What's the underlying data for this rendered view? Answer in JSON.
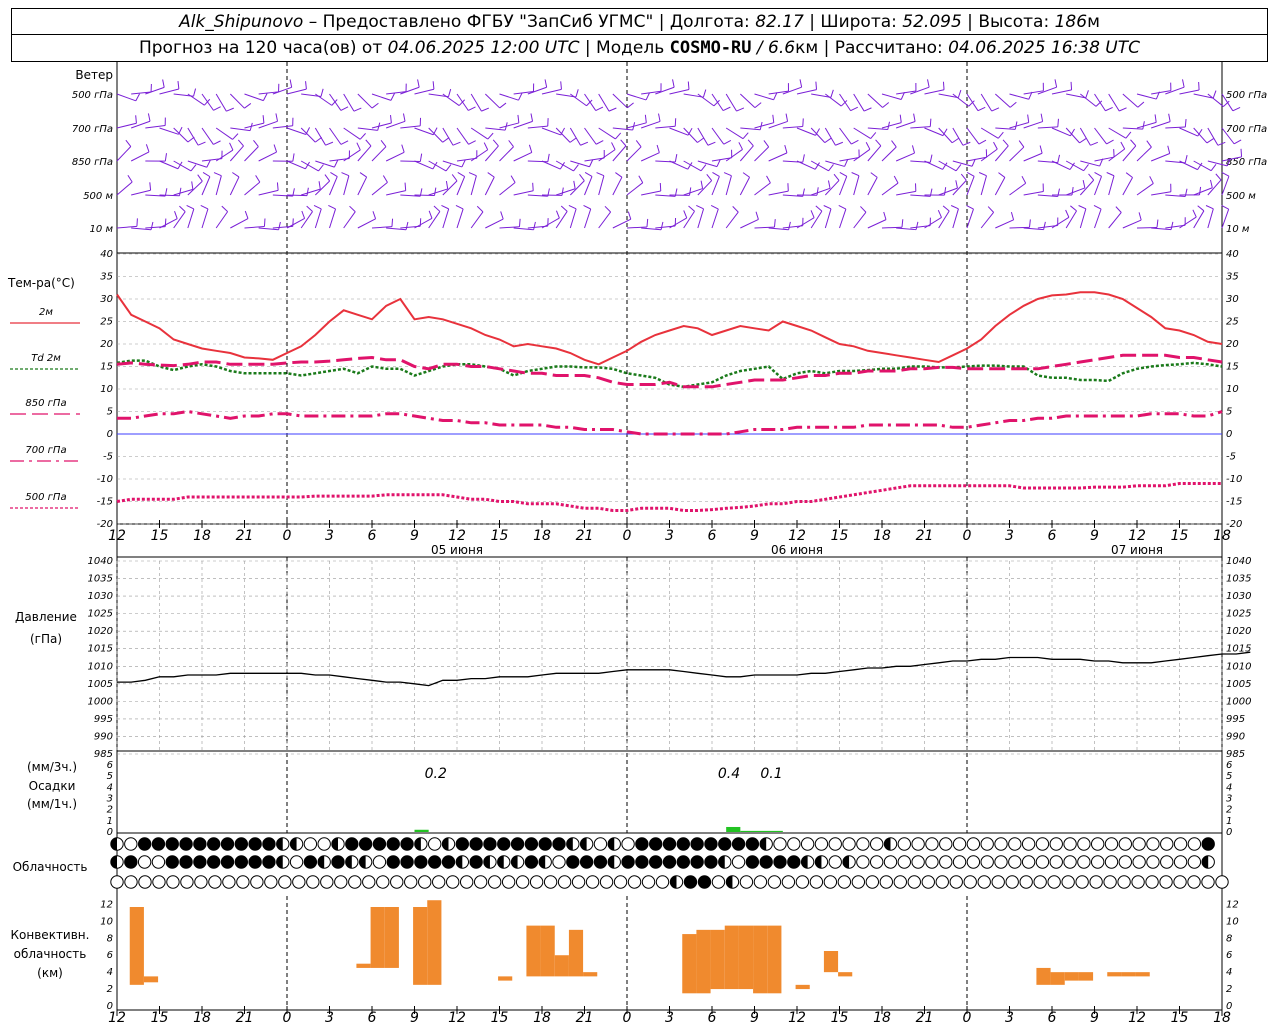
{
  "header": {
    "station": "Alk_Shipunovo",
    "provider": "– Предоставлено ФГБУ \"ЗапСиб УГМС\"",
    "lon_label": "Долгота:",
    "lon_value": "82.17",
    "lat_label": "Широта:",
    "lat_value": "52.095",
    "alt_label": "Высота:",
    "alt_value": "186",
    "alt_unit": "м",
    "forecast_prefix": "Прогноз на 120 часа(ов) от",
    "forecast_time": "04.06.2025 12:00 UTC",
    "model_label": "Модель",
    "model_name": "COSMO-RU",
    "model_res": "/ 6.6",
    "model_res_unit": "км",
    "calc_label": "Рассчитано:",
    "calc_time": "04.06.2025 16:38 UTC"
  },
  "wind_panel": {
    "title": "Ветер",
    "levels": [
      "500 гПа",
      "700 гПа",
      "850 гПа",
      "500 м",
      "10  м"
    ],
    "barb_color": "#7a1fd6"
  },
  "colors": {
    "t2m": "#e8323c",
    "td2m": "#1a7a1a",
    "t850": "#e0136b",
    "zero_line": "#3c3cff",
    "pressure": "#000000",
    "precip": "#22c322",
    "conv": "#f08a2e"
  },
  "x_ticks": [
    "12",
    "15",
    "18",
    "21",
    "0",
    "3",
    "6",
    "9",
    "12",
    "15",
    "18",
    "21",
    "0",
    "3",
    "6",
    "9",
    "12",
    "15",
    "18",
    "21",
    "0",
    "3",
    "6",
    "9",
    "12",
    "15",
    "18"
  ],
  "date_labels": [
    "05 июня",
    "06 июня",
    "07 июня"
  ],
  "cloud_panel": {
    "title": "Облачность"
  },
  "chart_data": [
    {
      "type": "line",
      "title": "Тем-ра(°C)",
      "ylim": [
        -20,
        40
      ],
      "yticks": [
        "40",
        "35",
        "30",
        "25",
        "20",
        "15",
        "10",
        "5",
        "0",
        "-5",
        "-10",
        "-15",
        "-20"
      ],
      "x_hours": [
        0,
        1,
        2,
        3,
        4,
        5,
        6,
        7,
        8,
        9,
        10,
        11,
        12,
        13,
        14,
        15,
        16,
        17,
        18,
        19,
        20,
        21,
        22,
        23,
        24,
        25,
        26,
        27,
        28,
        29,
        30,
        31,
        32,
        33,
        34,
        35,
        36,
        37,
        38,
        39,
        40,
        41,
        42,
        43,
        44,
        45,
        46,
        47,
        48,
        49,
        50,
        51,
        52,
        53,
        54,
        55,
        56,
        57,
        58,
        59,
        60,
        61,
        62,
        63,
        64,
        65,
        66,
        67,
        68,
        69,
        70,
        71,
        72,
        73,
        74,
        75,
        76,
        77,
        78
      ],
      "series": [
        {
          "name": "2м",
          "values": [
            31,
            26.5,
            25,
            23.5,
            21,
            20,
            19,
            18.5,
            18,
            17,
            16.8,
            16.5,
            18,
            19.5,
            22,
            25,
            27.5,
            26.5,
            25.5,
            28.5,
            30,
            25.5,
            26,
            25.5,
            24.5,
            23.5,
            22,
            21,
            19.5,
            20,
            19.5,
            19,
            18,
            16.5,
            15.5,
            17,
            18.5,
            20.5,
            22,
            23,
            24,
            23.5,
            22,
            23,
            24,
            23.5,
            23,
            25,
            24,
            23,
            21.5,
            20,
            19.5,
            18.5,
            18,
            17.5,
            17,
            16.5,
            16,
            17.5,
            19,
            21,
            24,
            26.5,
            28.5,
            30,
            30.8,
            31,
            31.5,
            31.5,
            31,
            30,
            28,
            26,
            23.5,
            23,
            22,
            20.5,
            20
          ]
        },
        {
          "name": "Td  2м",
          "values": [
            15.8,
            16.3,
            16.3,
            15,
            14.2,
            15,
            15.5,
            15,
            14,
            13.5,
            13.5,
            13.5,
            13.5,
            13,
            13.5,
            14,
            14.5,
            13.5,
            15,
            14.5,
            14.5,
            13,
            14,
            15,
            15.5,
            15.5,
            15,
            14.5,
            13,
            14,
            14.5,
            15,
            15,
            14.8,
            14.8,
            14.5,
            13.5,
            13,
            12.5,
            11,
            10.5,
            11,
            11.5,
            13,
            14,
            14.5,
            15,
            12.2,
            13.5,
            14,
            13.5,
            14,
            14,
            14.2,
            14.5,
            14.5,
            15,
            15,
            14.8,
            14.8,
            15,
            15.2,
            15.2,
            15,
            15,
            13,
            12.5,
            12.5,
            12,
            12,
            11.8,
            13.5,
            14.5,
            15,
            15.3,
            15.5,
            15.8,
            15.5,
            15
          ]
        },
        {
          "name": "850 гПа",
          "values": [
            15.5,
            15.8,
            15.5,
            15.3,
            15.2,
            15.5,
            16,
            16,
            15.5,
            15.5,
            15.5,
            15.5,
            15.8,
            16,
            16,
            16.2,
            16.5,
            16.8,
            17,
            16.5,
            16.5,
            15,
            14.5,
            15.5,
            15.5,
            15,
            15,
            14.5,
            14,
            13.5,
            13.5,
            13,
            13,
            13,
            12.5,
            11.5,
            11,
            11,
            11,
            11.5,
            10.5,
            10.5,
            10.5,
            11,
            11.5,
            12,
            12,
            12,
            12.5,
            13,
            13,
            13.5,
            13.5,
            14,
            14,
            14,
            14.5,
            14.5,
            14.8,
            14.8,
            14.5,
            14.5,
            14.5,
            14.5,
            14.5,
            14.5,
            15,
            15.5,
            16,
            16.5,
            17,
            17.5,
            17.5,
            17.5,
            17.5,
            17,
            17,
            16.5,
            16
          ]
        },
        {
          "name": "700 гПа",
          "values": [
            3.5,
            3.5,
            4,
            4.5,
            4.5,
            5,
            4.5,
            4,
            3.5,
            4,
            4,
            4.5,
            4.5,
            4,
            4,
            4,
            4,
            4,
            4,
            4.5,
            4.5,
            4,
            3.5,
            3,
            3,
            2.5,
            2.5,
            2,
            2,
            2,
            2,
            1.5,
            1.5,
            1,
            1,
            1,
            0.5,
            0,
            0,
            0,
            0,
            0,
            0,
            0,
            0.5,
            1,
            1,
            1,
            1.5,
            1.5,
            1.5,
            1.5,
            1.5,
            2,
            2,
            2,
            2,
            2,
            2,
            1.5,
            1.5,
            2,
            2.5,
            3,
            3,
            3.5,
            3.5,
            4,
            4,
            4,
            4,
            4,
            4,
            4.5,
            4.5,
            4.5,
            4,
            4,
            5
          ]
        },
        {
          "name": "500 гПа",
          "values": [
            -15,
            -14.5,
            -14.5,
            -14.5,
            -14.5,
            -14,
            -14,
            -14,
            -14,
            -14,
            -14,
            -14,
            -14,
            -14,
            -13.8,
            -13.8,
            -13.8,
            -13.8,
            -13.8,
            -13.5,
            -13.5,
            -13.5,
            -13.5,
            -13.5,
            -14,
            -14.5,
            -14.5,
            -15,
            -15,
            -15.5,
            -15.5,
            -15.5,
            -16,
            -16.5,
            -16.5,
            -17,
            -17,
            -16.5,
            -16.5,
            -16.5,
            -17,
            -17,
            -16.8,
            -16.5,
            -16.3,
            -16,
            -15.5,
            -15.5,
            -15,
            -15,
            -14.5,
            -14,
            -13.5,
            -13,
            -12.5,
            -12,
            -11.5,
            -11.5,
            -11.5,
            -11.5,
            -11.5,
            -11.5,
            -11.5,
            -11.5,
            -12,
            -12,
            -12,
            -12,
            -12,
            -11.8,
            -11.8,
            -11.8,
            -11.5,
            -11.5,
            -11.5,
            -11,
            -11,
            -11,
            -11
          ]
        }
      ]
    },
    {
      "type": "line",
      "title": "Давление",
      "ylabel": "(гПа)",
      "ylim": [
        985,
        1040
      ],
      "yticks": [
        "1040",
        "1035",
        "1030",
        "1025",
        "1020",
        "1015",
        "1010",
        "1005",
        "1000",
        "995",
        "990",
        "985"
      ],
      "x_hours_step": 1,
      "series": [
        {
          "name": "Давление",
          "values": [
            1005.5,
            1005.5,
            1006,
            1007,
            1007,
            1007.5,
            1007.5,
            1007.5,
            1008,
            1008,
            1008,
            1008,
            1008,
            1008,
            1007.5,
            1007.5,
            1007,
            1006.5,
            1006,
            1005.5,
            1005.5,
            1005,
            1004.5,
            1006,
            1006,
            1006.5,
            1006.5,
            1007,
            1007,
            1007,
            1007.5,
            1008,
            1008,
            1008,
            1008,
            1008.5,
            1009,
            1009,
            1009,
            1009,
            1008.5,
            1008,
            1007.5,
            1007,
            1007,
            1007.5,
            1007.5,
            1007.5,
            1007.5,
            1008,
            1008,
            1008.5,
            1009,
            1009.5,
            1009.5,
            1010,
            1010,
            1010.5,
            1011,
            1011.5,
            1011.5,
            1012,
            1012,
            1012.5,
            1012.5,
            1012.5,
            1012,
            1012,
            1012,
            1011.5,
            1011.5,
            1011,
            1011,
            1011,
            1011.5,
            1012,
            1012.5,
            1013,
            1013.5,
            1013.5,
            1014
          ]
        }
      ]
    },
    {
      "type": "bar",
      "title": "Осадки",
      "ylabel": "(мм/3ч.)",
      "ylabel2": "(мм/1ч.)",
      "ylim": [
        0,
        6
      ],
      "yticks": [
        "6",
        "5",
        "4",
        "3",
        "2",
        "1",
        "0"
      ],
      "bars": [
        {
          "hour": 21,
          "width_h": 1,
          "value": 0.2
        },
        {
          "hour": 43,
          "width_h": 1,
          "value": 0.45
        },
        {
          "hour": 44,
          "width_h": 3,
          "value": 0.1
        }
      ],
      "annotations": [
        "0.2",
        "0.4",
        "0.1"
      ]
    },
    {
      "type": "bar",
      "title": "Конвективн.",
      "subtitle": "облачность",
      "ylabel": "(км)",
      "ylim": [
        0,
        13
      ],
      "yticks": [
        "12",
        "10",
        "8",
        "6",
        "4",
        "2",
        "0"
      ],
      "bars": [
        {
          "hour": 1,
          "base": 2.5,
          "top": 11.7
        },
        {
          "hour": 2,
          "base": 2.8,
          "top": 3.5
        },
        {
          "hour": 17,
          "base": 4.5,
          "top": 5
        },
        {
          "hour": 18,
          "base": 4.5,
          "top": 11.7
        },
        {
          "hour": 19,
          "base": 4.5,
          "top": 11.7
        },
        {
          "hour": 21,
          "base": 2.5,
          "top": 11.7
        },
        {
          "hour": 22,
          "base": 2.5,
          "top": 12.5
        },
        {
          "hour": 27,
          "base": 3,
          "top": 3.5
        },
        {
          "hour": 29,
          "base": 3.5,
          "top": 9.5
        },
        {
          "hour": 30,
          "base": 3.5,
          "top": 9.5
        },
        {
          "hour": 31,
          "base": 3.5,
          "top": 6
        },
        {
          "hour": 32,
          "base": 3.5,
          "top": 9
        },
        {
          "hour": 33,
          "base": 3.5,
          "top": 4
        },
        {
          "hour": 40,
          "base": 1.5,
          "top": 8.5
        },
        {
          "hour": 41,
          "base": 1.5,
          "top": 9
        },
        {
          "hour": 42,
          "base": 2,
          "top": 9
        },
        {
          "hour": 43,
          "base": 2,
          "top": 9.5
        },
        {
          "hour": 44,
          "base": 2,
          "top": 9.5
        },
        {
          "hour": 45,
          "base": 1.5,
          "top": 9.5
        },
        {
          "hour": 46,
          "base": 1.5,
          "top": 9.5
        },
        {
          "hour": 48,
          "base": 2,
          "top": 2.5
        },
        {
          "hour": 50,
          "base": 4,
          "top": 6.5
        },
        {
          "hour": 51,
          "base": 3.5,
          "top": 4
        },
        {
          "hour": 65,
          "base": 2.5,
          "top": 4.5
        },
        {
          "hour": 66,
          "base": 2.5,
          "top": 4
        },
        {
          "hour": 67,
          "base": 3,
          "top": 4
        },
        {
          "hour": 68,
          "base": 3,
          "top": 4
        },
        {
          "hour": 70,
          "base": 3.5,
          "top": 4
        },
        {
          "hour": 71,
          "base": 3.5,
          "top": 4
        },
        {
          "hour": 72,
          "base": 3.5,
          "top": 4
        }
      ]
    }
  ],
  "cloud_rows": [
    "HOFFFFFFFFFFHHOOHFFFFFHOHFFFFFFFFHHOHOFFFFFFFFFHOOOOOOOOHOOOOOOOOOOOOOOOOOOOOOOFH",
    "HFOOFFFFFFFFHOFHFHHOFFFFFHFHHHFHOFFFHFFFFFFFHOFFFFHHOHOOOOOOOOOOOOOOOOOOOOOOOOOHF",
    "OOOOOOOOOOOOOOOOOOOOOOOOOOOOOOOOOOOOOOOOHFFOHOOOOOOOOOOOOOOOOOOOOOOOOOOOOOOOOOOO"
  ]
}
